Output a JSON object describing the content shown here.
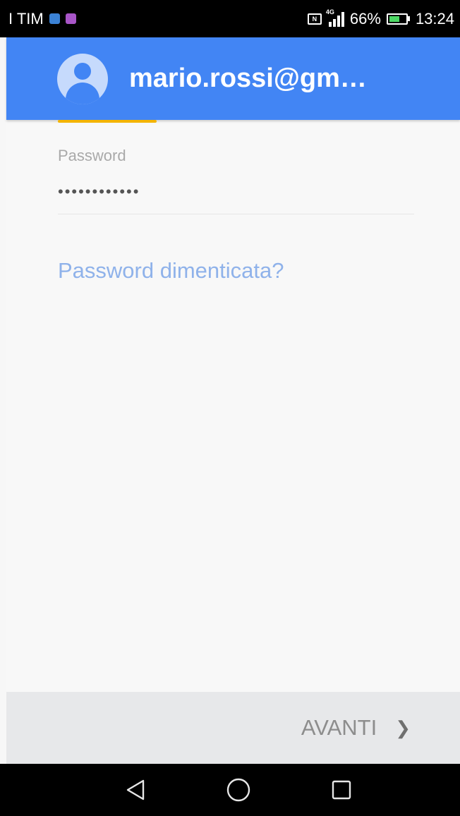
{
  "status_bar": {
    "carrier": "I TIM",
    "network": "4G",
    "battery_level": "66%",
    "battery_fraction": 0.66,
    "time": "13:24",
    "app_badges": [
      "#3b82d6",
      "#a855c7"
    ],
    "battery_fill_color": "#4cd964"
  },
  "header": {
    "account": "mario.rossi@gm…",
    "avatar_icon": "account-circle-icon",
    "background_color": "#4285f4",
    "progress_color": "#f4b400"
  },
  "form": {
    "password_label": "Password",
    "password_value": "••••••••••••",
    "forgot_link": "Password dimenticata?",
    "link_color": "#8fb2ea"
  },
  "footer": {
    "next_label": "AVANTI",
    "next_icon": "chevron-right-icon",
    "background_color": "#e7e8ea"
  },
  "nav": {
    "icons": [
      "back-triangle-icon",
      "home-circle-icon",
      "recents-square-icon"
    ]
  }
}
